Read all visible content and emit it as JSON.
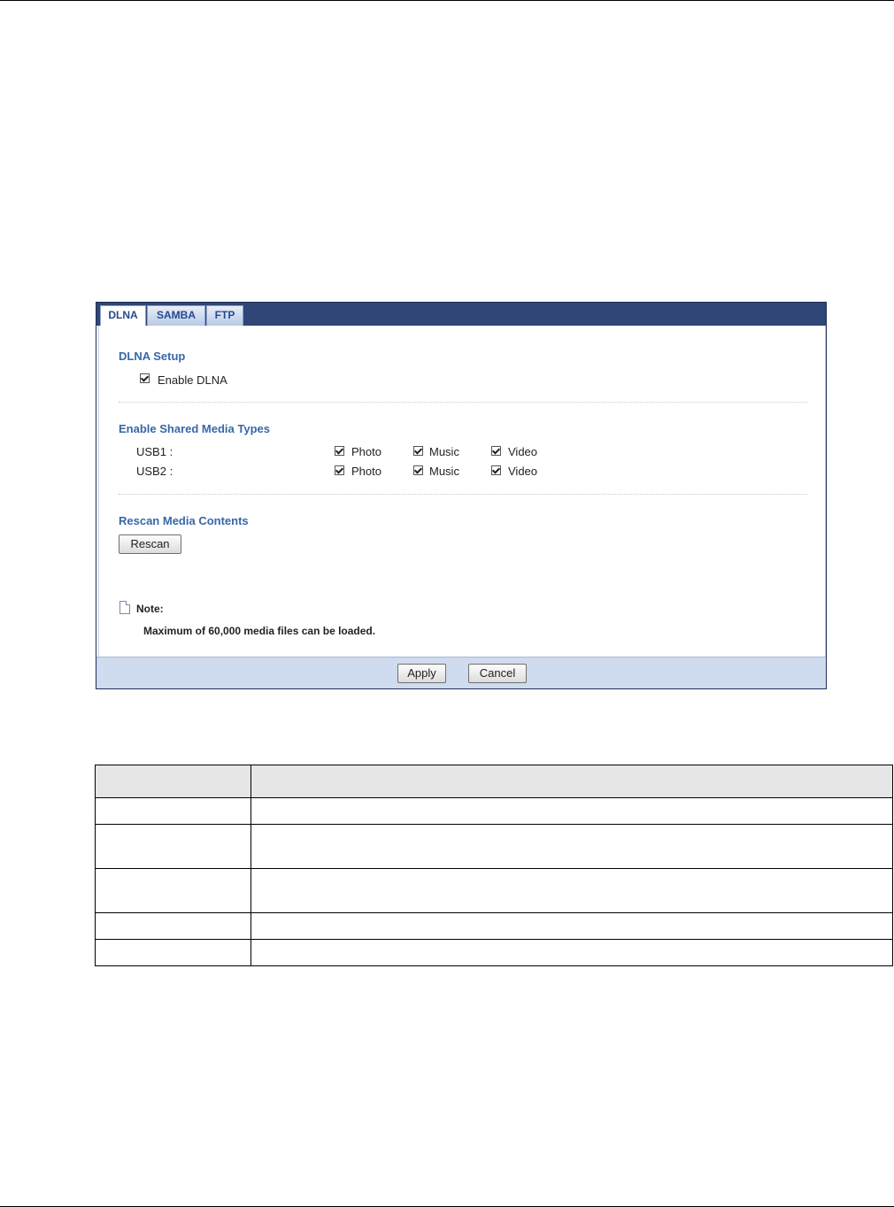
{
  "tabs": [
    {
      "label": "DLNA",
      "active": true
    },
    {
      "label": "SAMBA",
      "active": false
    },
    {
      "label": "FTP",
      "active": false
    }
  ],
  "dlna_setup": {
    "title": "DLNA Setup",
    "enable_label": "Enable DLNA",
    "enable_checked": true
  },
  "media_types": {
    "title": "Enable Shared Media Types",
    "rows": [
      {
        "label": "USB1 :",
        "photo": "Photo",
        "music": "Music",
        "video": "Video",
        "photo_checked": true,
        "music_checked": true,
        "video_checked": true
      },
      {
        "label": "USB2 :",
        "photo": "Photo",
        "music": "Music",
        "video": "Video",
        "photo_checked": true,
        "music_checked": true,
        "video_checked": true
      }
    ]
  },
  "rescan": {
    "title": "Rescan Media Contents",
    "button": "Rescan"
  },
  "note": {
    "title": "Note:",
    "text": "Maximum of 60,000 media files can be loaded."
  },
  "footer": {
    "apply": "Apply",
    "cancel": "Cancel"
  },
  "colors": {
    "tabbar": "#2f4677",
    "section_title": "#3668a8",
    "footer": "#cfdbee"
  },
  "table": {
    "header": [
      "",
      ""
    ],
    "rows": [
      [
        "",
        ""
      ],
      [
        "",
        ""
      ],
      [
        "",
        ""
      ],
      [
        "",
        ""
      ],
      [
        "",
        ""
      ]
    ]
  }
}
